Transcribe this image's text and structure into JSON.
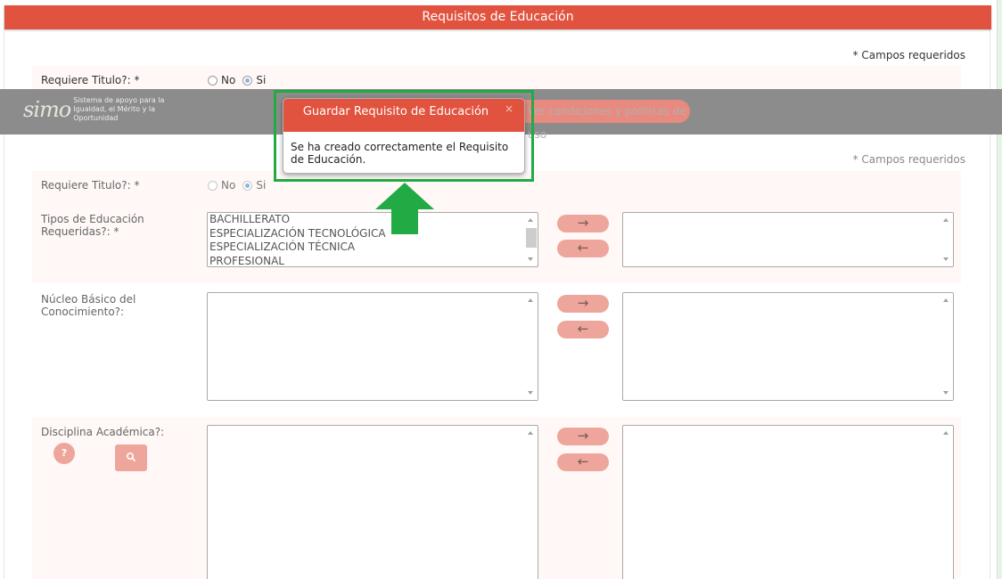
{
  "panel": {
    "title": "Requisitos de Educación",
    "required_note": "* Campos requeridos"
  },
  "form_top": {
    "titulo_label": "Requiere Titulo?: *",
    "no_label": "No",
    "si_label": "Si",
    "selected": "Si"
  },
  "form": {
    "titulo_label": "Requiere Titulo?: *",
    "no_label": "No",
    "si_label": "Si",
    "selected": "Si",
    "tipos_label": "Tipos de Educación Requeridas?: *",
    "tipos_options": [
      "BACHILLERATO",
      "ESPECIALIZACIÓN TECNOLÓGICA",
      "ESPECIALIZACIÓN TÉCNICA",
      "PROFESIONAL"
    ],
    "nucleo_label": "Núcleo Básico del Conocimiento?:",
    "disciplina_label": "Disciplina Académica?:",
    "move_right": "→",
    "move_left": "←",
    "help_label": "?"
  },
  "overlay": {
    "logo_mark": "simo",
    "logo_text": "Sistema de apoyo para la Igualdad, el Mérito y la Oportunidad",
    "policy_button": "Ver condiciones y politicas de uso"
  },
  "dialog": {
    "title": "Guardar Requisito de Educación",
    "close": "×",
    "message": "Se ha creado correctamente el Requisito de Educación."
  },
  "colors": {
    "accent": "#e1533f",
    "highlight": "#22aa44",
    "overlay": "#8c8c8c"
  },
  "icons": [
    "search-icon",
    "arrow-right-icon",
    "arrow-left-icon",
    "close-icon",
    "help-icon",
    "arrow-up-icon"
  ]
}
